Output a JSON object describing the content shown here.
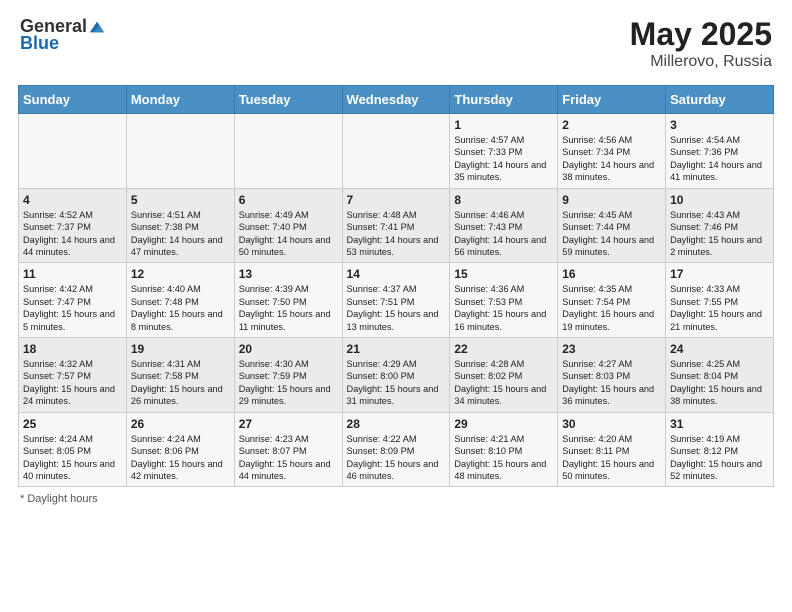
{
  "header": {
    "logo_general": "General",
    "logo_blue": "Blue",
    "title": "May 2025",
    "subtitle": "Millerovo, Russia"
  },
  "days_of_week": [
    "Sunday",
    "Monday",
    "Tuesday",
    "Wednesday",
    "Thursday",
    "Friday",
    "Saturday"
  ],
  "footer": {
    "note": "Daylight hours"
  },
  "weeks": [
    [
      {
        "day": "",
        "sunrise": "",
        "sunset": "",
        "daylight": ""
      },
      {
        "day": "",
        "sunrise": "",
        "sunset": "",
        "daylight": ""
      },
      {
        "day": "",
        "sunrise": "",
        "sunset": "",
        "daylight": ""
      },
      {
        "day": "",
        "sunrise": "",
        "sunset": "",
        "daylight": ""
      },
      {
        "day": "1",
        "sunrise": "Sunrise: 4:57 AM",
        "sunset": "Sunset: 7:33 PM",
        "daylight": "Daylight: 14 hours and 35 minutes."
      },
      {
        "day": "2",
        "sunrise": "Sunrise: 4:56 AM",
        "sunset": "Sunset: 7:34 PM",
        "daylight": "Daylight: 14 hours and 38 minutes."
      },
      {
        "day": "3",
        "sunrise": "Sunrise: 4:54 AM",
        "sunset": "Sunset: 7:36 PM",
        "daylight": "Daylight: 14 hours and 41 minutes."
      }
    ],
    [
      {
        "day": "4",
        "sunrise": "Sunrise: 4:52 AM",
        "sunset": "Sunset: 7:37 PM",
        "daylight": "Daylight: 14 hours and 44 minutes."
      },
      {
        "day": "5",
        "sunrise": "Sunrise: 4:51 AM",
        "sunset": "Sunset: 7:38 PM",
        "daylight": "Daylight: 14 hours and 47 minutes."
      },
      {
        "day": "6",
        "sunrise": "Sunrise: 4:49 AM",
        "sunset": "Sunset: 7:40 PM",
        "daylight": "Daylight: 14 hours and 50 minutes."
      },
      {
        "day": "7",
        "sunrise": "Sunrise: 4:48 AM",
        "sunset": "Sunset: 7:41 PM",
        "daylight": "Daylight: 14 hours and 53 minutes."
      },
      {
        "day": "8",
        "sunrise": "Sunrise: 4:46 AM",
        "sunset": "Sunset: 7:43 PM",
        "daylight": "Daylight: 14 hours and 56 minutes."
      },
      {
        "day": "9",
        "sunrise": "Sunrise: 4:45 AM",
        "sunset": "Sunset: 7:44 PM",
        "daylight": "Daylight: 14 hours and 59 minutes."
      },
      {
        "day": "10",
        "sunrise": "Sunrise: 4:43 AM",
        "sunset": "Sunset: 7:46 PM",
        "daylight": "Daylight: 15 hours and 2 minutes."
      }
    ],
    [
      {
        "day": "11",
        "sunrise": "Sunrise: 4:42 AM",
        "sunset": "Sunset: 7:47 PM",
        "daylight": "Daylight: 15 hours and 5 minutes."
      },
      {
        "day": "12",
        "sunrise": "Sunrise: 4:40 AM",
        "sunset": "Sunset: 7:48 PM",
        "daylight": "Daylight: 15 hours and 8 minutes."
      },
      {
        "day": "13",
        "sunrise": "Sunrise: 4:39 AM",
        "sunset": "Sunset: 7:50 PM",
        "daylight": "Daylight: 15 hours and 11 minutes."
      },
      {
        "day": "14",
        "sunrise": "Sunrise: 4:37 AM",
        "sunset": "Sunset: 7:51 PM",
        "daylight": "Daylight: 15 hours and 13 minutes."
      },
      {
        "day": "15",
        "sunrise": "Sunrise: 4:36 AM",
        "sunset": "Sunset: 7:53 PM",
        "daylight": "Daylight: 15 hours and 16 minutes."
      },
      {
        "day": "16",
        "sunrise": "Sunrise: 4:35 AM",
        "sunset": "Sunset: 7:54 PM",
        "daylight": "Daylight: 15 hours and 19 minutes."
      },
      {
        "day": "17",
        "sunrise": "Sunrise: 4:33 AM",
        "sunset": "Sunset: 7:55 PM",
        "daylight": "Daylight: 15 hours and 21 minutes."
      }
    ],
    [
      {
        "day": "18",
        "sunrise": "Sunrise: 4:32 AM",
        "sunset": "Sunset: 7:57 PM",
        "daylight": "Daylight: 15 hours and 24 minutes."
      },
      {
        "day": "19",
        "sunrise": "Sunrise: 4:31 AM",
        "sunset": "Sunset: 7:58 PM",
        "daylight": "Daylight: 15 hours and 26 minutes."
      },
      {
        "day": "20",
        "sunrise": "Sunrise: 4:30 AM",
        "sunset": "Sunset: 7:59 PM",
        "daylight": "Daylight: 15 hours and 29 minutes."
      },
      {
        "day": "21",
        "sunrise": "Sunrise: 4:29 AM",
        "sunset": "Sunset: 8:00 PM",
        "daylight": "Daylight: 15 hours and 31 minutes."
      },
      {
        "day": "22",
        "sunrise": "Sunrise: 4:28 AM",
        "sunset": "Sunset: 8:02 PM",
        "daylight": "Daylight: 15 hours and 34 minutes."
      },
      {
        "day": "23",
        "sunrise": "Sunrise: 4:27 AM",
        "sunset": "Sunset: 8:03 PM",
        "daylight": "Daylight: 15 hours and 36 minutes."
      },
      {
        "day": "24",
        "sunrise": "Sunrise: 4:25 AM",
        "sunset": "Sunset: 8:04 PM",
        "daylight": "Daylight: 15 hours and 38 minutes."
      }
    ],
    [
      {
        "day": "25",
        "sunrise": "Sunrise: 4:24 AM",
        "sunset": "Sunset: 8:05 PM",
        "daylight": "Daylight: 15 hours and 40 minutes."
      },
      {
        "day": "26",
        "sunrise": "Sunrise: 4:24 AM",
        "sunset": "Sunset: 8:06 PM",
        "daylight": "Daylight: 15 hours and 42 minutes."
      },
      {
        "day": "27",
        "sunrise": "Sunrise: 4:23 AM",
        "sunset": "Sunset: 8:07 PM",
        "daylight": "Daylight: 15 hours and 44 minutes."
      },
      {
        "day": "28",
        "sunrise": "Sunrise: 4:22 AM",
        "sunset": "Sunset: 8:09 PM",
        "daylight": "Daylight: 15 hours and 46 minutes."
      },
      {
        "day": "29",
        "sunrise": "Sunrise: 4:21 AM",
        "sunset": "Sunset: 8:10 PM",
        "daylight": "Daylight: 15 hours and 48 minutes."
      },
      {
        "day": "30",
        "sunrise": "Sunrise: 4:20 AM",
        "sunset": "Sunset: 8:11 PM",
        "daylight": "Daylight: 15 hours and 50 minutes."
      },
      {
        "day": "31",
        "sunrise": "Sunrise: 4:19 AM",
        "sunset": "Sunset: 8:12 PM",
        "daylight": "Daylight: 15 hours and 52 minutes."
      }
    ]
  ]
}
